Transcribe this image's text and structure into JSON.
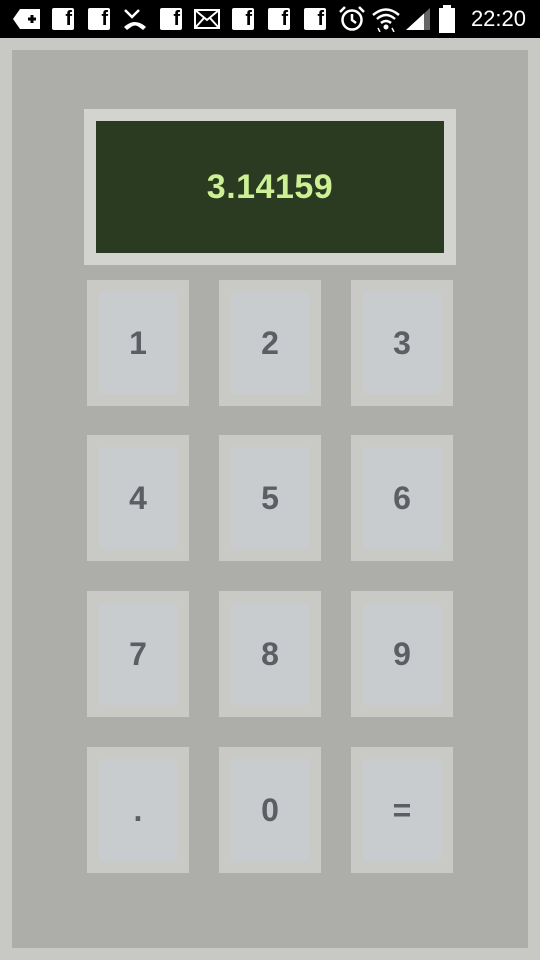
{
  "status_bar": {
    "time": "22:20",
    "icons": [
      "add-icon",
      "facebook-icon",
      "facebook-icon",
      "missed-call-icon",
      "facebook-icon",
      "email-icon",
      "facebook-icon",
      "facebook-icon",
      "facebook-icon",
      "alarm-icon",
      "wifi-icon",
      "signal-icon",
      "battery-icon"
    ],
    "facebook_glyph": "f"
  },
  "display": {
    "value": "3.14159"
  },
  "keypad": {
    "keys": [
      "1",
      "2",
      "3",
      "4",
      "5",
      "6",
      "7",
      "8",
      "9",
      ".",
      "0",
      "="
    ]
  },
  "colors": {
    "display_background": "#2a3b22",
    "display_text": "#cdf095",
    "panel": "#adaea9",
    "key_text": "#5b5e62"
  }
}
